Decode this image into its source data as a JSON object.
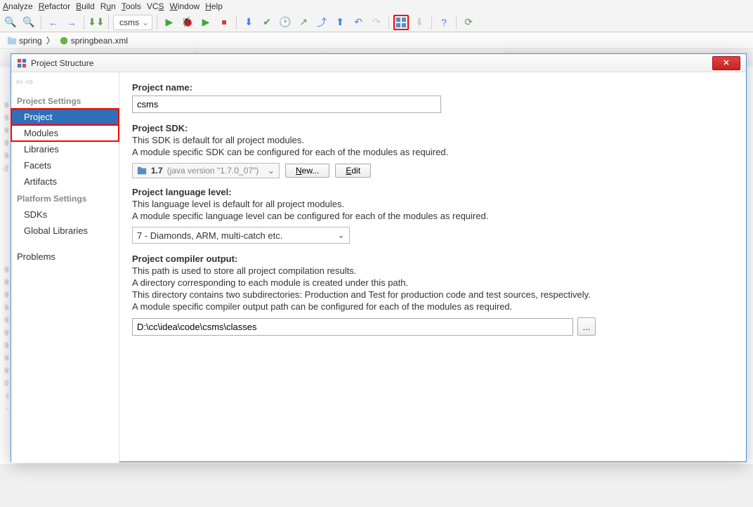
{
  "menus": {
    "analyze": "Analyze",
    "refactor": "Refactor",
    "build": "Build",
    "run": "Run",
    "tools": "Tools",
    "vcs": "VCS",
    "window": "Window",
    "help": "Help"
  },
  "runconfig": {
    "name": "csms"
  },
  "breadcrumb": {
    "root": "spring",
    "file": "springbean.xml"
  },
  "dialog": {
    "title": "Project Structure",
    "sidebar": {
      "cat1": "Project Settings",
      "items1": [
        "Project",
        "Modules",
        "Libraries",
        "Facets",
        "Artifacts"
      ],
      "cat2": "Platform Settings",
      "items2": [
        "SDKs",
        "Global Libraries"
      ],
      "cat3": "",
      "items3": [
        "Problems"
      ]
    },
    "project": {
      "name_label": "Project name:",
      "name_value": "csms",
      "sdk_label": "Project SDK:",
      "sdk_desc1": "This SDK is default for all project modules.",
      "sdk_desc2": "A module specific SDK can be configured for each of the modules as required.",
      "sdk_version": "1.7",
      "sdk_java": "(java version \"1.7.0_07\")",
      "new_btn": "New...",
      "edit_btn": "Edit",
      "lvl_label": "Project language level:",
      "lvl_desc1": "This language level is default for all project modules.",
      "lvl_desc2": "A module specific language level can be configured for each of the modules as required.",
      "lvl_value": "7 - Diamonds, ARM, multi-catch etc.",
      "out_label": "Project compiler output:",
      "out_desc1": "This path is used to store all project compilation results.",
      "out_desc2": "A directory corresponding to each module is created under this path.",
      "out_desc3": "This directory contains two subdirectories: Production and Test for production code and test sources, respectively.",
      "out_desc4": "A module specific compiler output path can be configured for each of the modules as required.",
      "out_value": "D:\\cc\\idea\\code\\csms\\classes",
      "browse": "..."
    }
  }
}
